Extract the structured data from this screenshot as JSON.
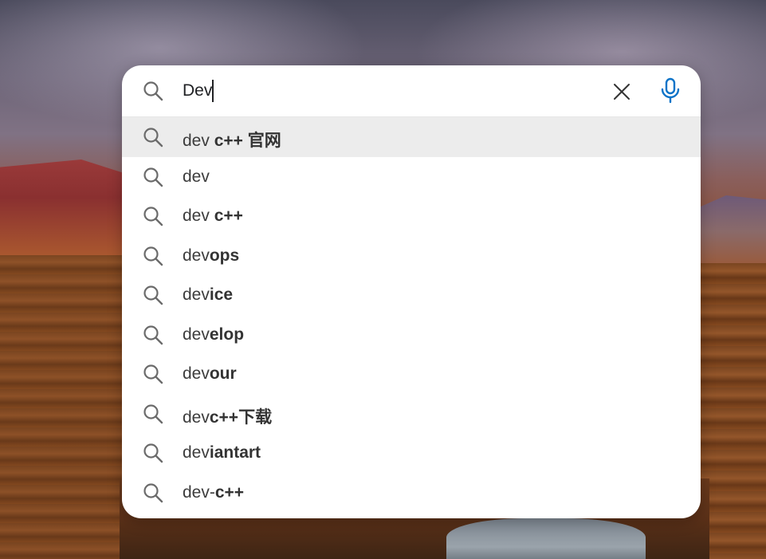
{
  "search": {
    "value": "Dev",
    "clear_icon": "close-icon",
    "mic_icon": "microphone-icon",
    "mic_color": "#0a73c8"
  },
  "suggestions": [
    {
      "typed": "dev ",
      "completion": "c++ 官网"
    },
    {
      "typed": "dev",
      "completion": ""
    },
    {
      "typed": "dev ",
      "completion": "c++"
    },
    {
      "typed": "dev",
      "completion": "ops"
    },
    {
      "typed": "dev",
      "completion": "ice"
    },
    {
      "typed": "dev",
      "completion": "elop"
    },
    {
      "typed": "dev",
      "completion": "our"
    },
    {
      "typed": "dev",
      "completion": "c++下载"
    },
    {
      "typed": "dev",
      "completion": "iantart"
    },
    {
      "typed": "dev-",
      "completion": "c++"
    }
  ]
}
